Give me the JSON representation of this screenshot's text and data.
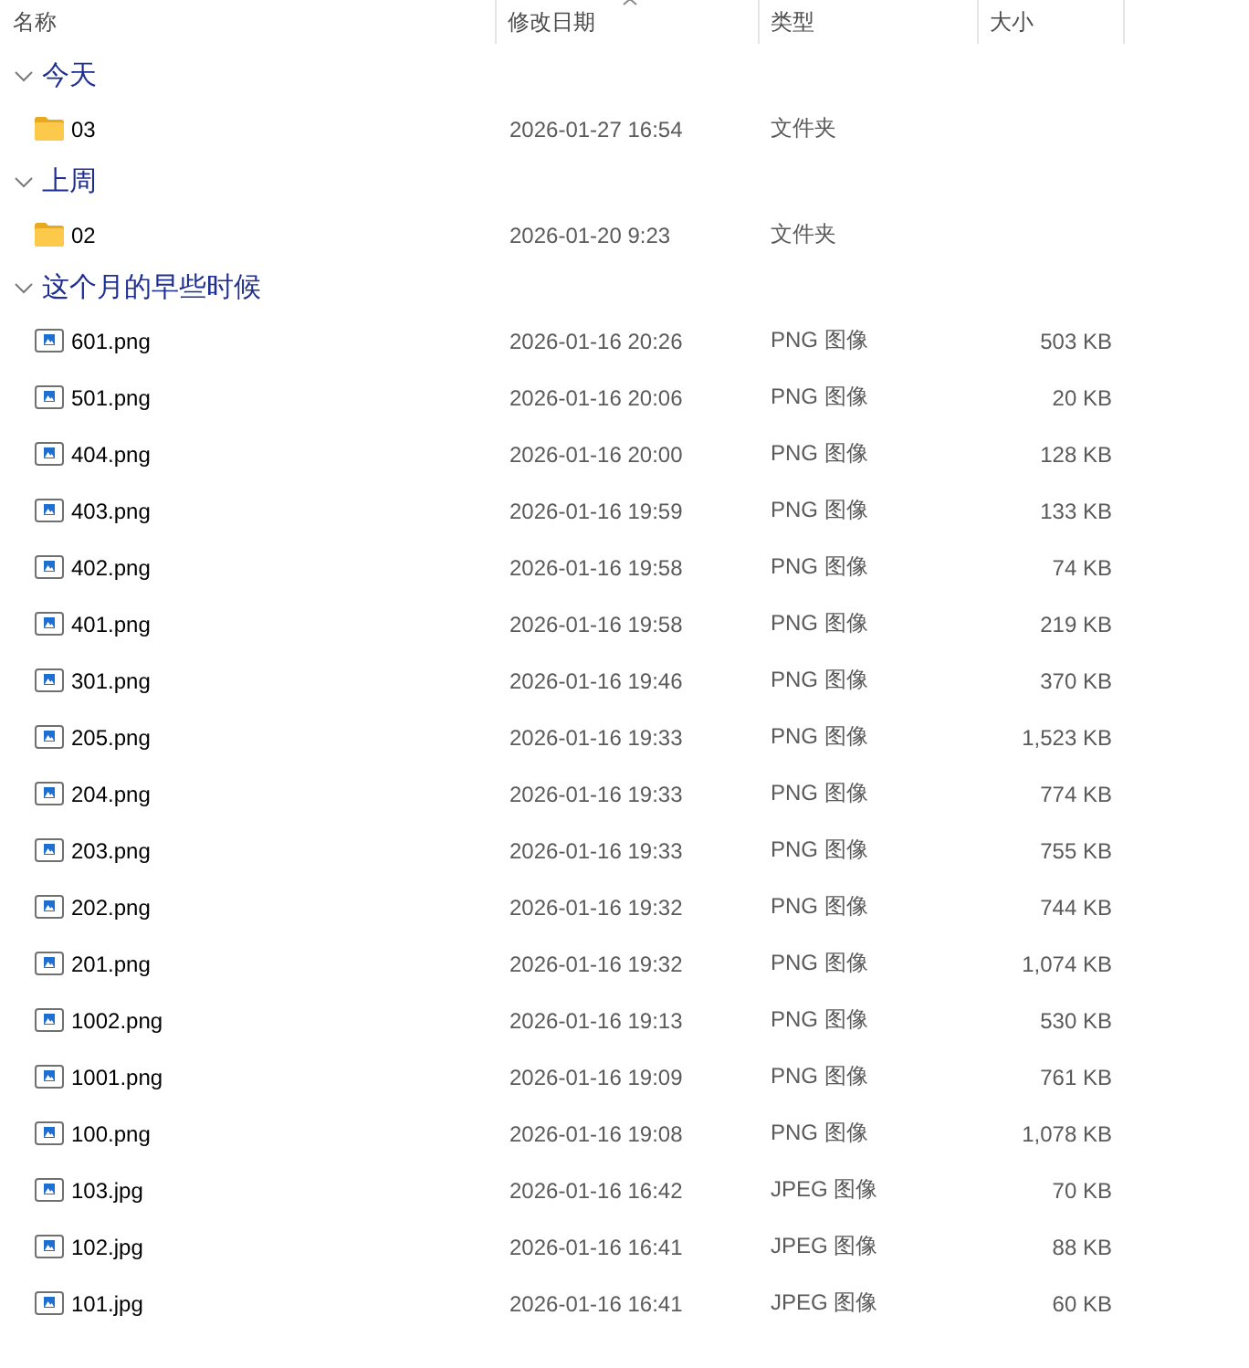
{
  "columns": [
    {
      "label": "名称",
      "sorted": false
    },
    {
      "label": "修改日期",
      "sorted": true
    },
    {
      "label": "类型",
      "sorted": false
    },
    {
      "label": "大小",
      "sorted": false
    }
  ],
  "groups": [
    {
      "label": "今天",
      "expanded": true,
      "items": [
        {
          "kind": "folder",
          "name": "03",
          "modified": "2026-01-27 16:54",
          "type": "文件夹"
        }
      ]
    },
    {
      "label": "上周",
      "expanded": true,
      "items": [
        {
          "kind": "folder",
          "name": "02",
          "modified": "2026-01-20 9:23",
          "type": "文件夹"
        }
      ]
    },
    {
      "label": "这个月的早些时候",
      "expanded": true,
      "items": [
        {
          "kind": "image",
          "name": "601.png",
          "modified": "2026-01-16 20:26",
          "type": "PNG 图像",
          "size": "503 KB"
        },
        {
          "kind": "image",
          "name": "501.png",
          "modified": "2026-01-16 20:06",
          "type": "PNG 图像",
          "size": "20 KB"
        },
        {
          "kind": "image",
          "name": "404.png",
          "modified": "2026-01-16 20:00",
          "type": "PNG 图像",
          "size": "128 KB"
        },
        {
          "kind": "image",
          "name": "403.png",
          "modified": "2026-01-16 19:59",
          "type": "PNG 图像",
          "size": "133 KB"
        },
        {
          "kind": "image",
          "name": "402.png",
          "modified": "2026-01-16 19:58",
          "type": "PNG 图像",
          "size": "74 KB"
        },
        {
          "kind": "image",
          "name": "401.png",
          "modified": "2026-01-16 19:58",
          "type": "PNG 图像",
          "size": "219 KB"
        },
        {
          "kind": "image",
          "name": "301.png",
          "modified": "2026-01-16 19:46",
          "type": "PNG 图像",
          "size": "370 KB"
        },
        {
          "kind": "image",
          "name": "205.png",
          "modified": "2026-01-16 19:33",
          "type": "PNG 图像",
          "size": "1,523 KB"
        },
        {
          "kind": "image",
          "name": "204.png",
          "modified": "2026-01-16 19:33",
          "type": "PNG 图像",
          "size": "774 KB"
        },
        {
          "kind": "image",
          "name": "203.png",
          "modified": "2026-01-16 19:33",
          "type": "PNG 图像",
          "size": "755 KB"
        },
        {
          "kind": "image",
          "name": "202.png",
          "modified": "2026-01-16 19:32",
          "type": "PNG 图像",
          "size": "744 KB"
        },
        {
          "kind": "image",
          "name": "201.png",
          "modified": "2026-01-16 19:32",
          "type": "PNG 图像",
          "size": "1,074 KB"
        },
        {
          "kind": "image",
          "name": "1002.png",
          "modified": "2026-01-16 19:13",
          "type": "PNG 图像",
          "size": "530 KB"
        },
        {
          "kind": "image",
          "name": "1001.png",
          "modified": "2026-01-16 19:09",
          "type": "PNG 图像",
          "size": "761 KB"
        },
        {
          "kind": "image",
          "name": "100.png",
          "modified": "2026-01-16 19:08",
          "type": "PNG 图像",
          "size": "1,078 KB"
        },
        {
          "kind": "image",
          "name": "103.jpg",
          "modified": "2026-01-16 16:42",
          "type": "JPEG 图像",
          "size": "70 KB"
        },
        {
          "kind": "image",
          "name": "102.jpg",
          "modified": "2026-01-16 16:41",
          "type": "JPEG 图像",
          "size": "88 KB"
        },
        {
          "kind": "image",
          "name": "101.jpg",
          "modified": "2026-01-16 16:41",
          "type": "JPEG 图像",
          "size": "60 KB"
        }
      ]
    }
  ]
}
